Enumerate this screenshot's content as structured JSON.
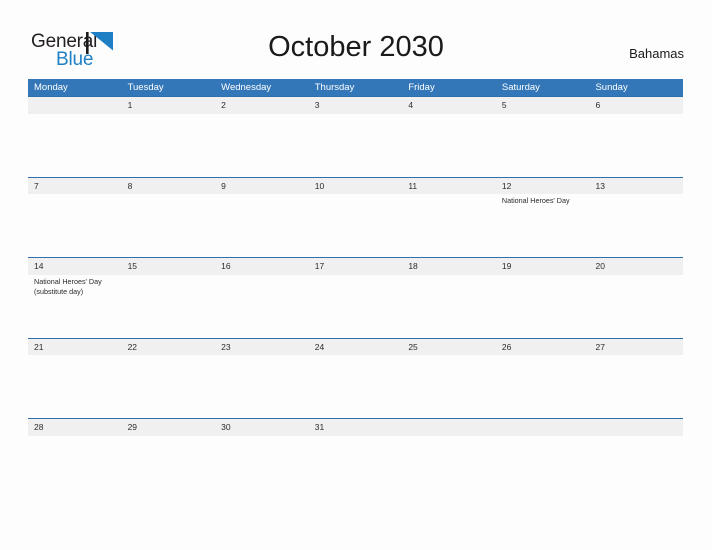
{
  "brand": {
    "name_part1": "General",
    "name_part2": "Blue",
    "flag_icon": "blue-triangle-flag",
    "color_dark": "#231f20",
    "color_blue": "#1f7fc4"
  },
  "header": {
    "title": "October 2030",
    "country": "Bahamas"
  },
  "calendar": {
    "accent_color": "#3377b8",
    "band_color": "#f0f0f0",
    "weekdays": [
      "Monday",
      "Tuesday",
      "Wednesday",
      "Thursday",
      "Friday",
      "Saturday",
      "Sunday"
    ],
    "weeks": [
      {
        "days": [
          {
            "num": "",
            "event": ""
          },
          {
            "num": "1",
            "event": ""
          },
          {
            "num": "2",
            "event": ""
          },
          {
            "num": "3",
            "event": ""
          },
          {
            "num": "4",
            "event": ""
          },
          {
            "num": "5",
            "event": ""
          },
          {
            "num": "6",
            "event": ""
          }
        ]
      },
      {
        "days": [
          {
            "num": "7",
            "event": ""
          },
          {
            "num": "8",
            "event": ""
          },
          {
            "num": "9",
            "event": ""
          },
          {
            "num": "10",
            "event": ""
          },
          {
            "num": "11",
            "event": ""
          },
          {
            "num": "12",
            "event": "National Heroes' Day"
          },
          {
            "num": "13",
            "event": ""
          }
        ]
      },
      {
        "days": [
          {
            "num": "14",
            "event": "National Heroes' Day (substitute day)"
          },
          {
            "num": "15",
            "event": ""
          },
          {
            "num": "16",
            "event": ""
          },
          {
            "num": "17",
            "event": ""
          },
          {
            "num": "18",
            "event": ""
          },
          {
            "num": "19",
            "event": ""
          },
          {
            "num": "20",
            "event": ""
          }
        ]
      },
      {
        "days": [
          {
            "num": "21",
            "event": ""
          },
          {
            "num": "22",
            "event": ""
          },
          {
            "num": "23",
            "event": ""
          },
          {
            "num": "24",
            "event": ""
          },
          {
            "num": "25",
            "event": ""
          },
          {
            "num": "26",
            "event": ""
          },
          {
            "num": "27",
            "event": ""
          }
        ]
      },
      {
        "days": [
          {
            "num": "28",
            "event": ""
          },
          {
            "num": "29",
            "event": ""
          },
          {
            "num": "30",
            "event": ""
          },
          {
            "num": "31",
            "event": ""
          },
          {
            "num": "",
            "event": ""
          },
          {
            "num": "",
            "event": ""
          },
          {
            "num": "",
            "event": ""
          }
        ]
      }
    ]
  }
}
